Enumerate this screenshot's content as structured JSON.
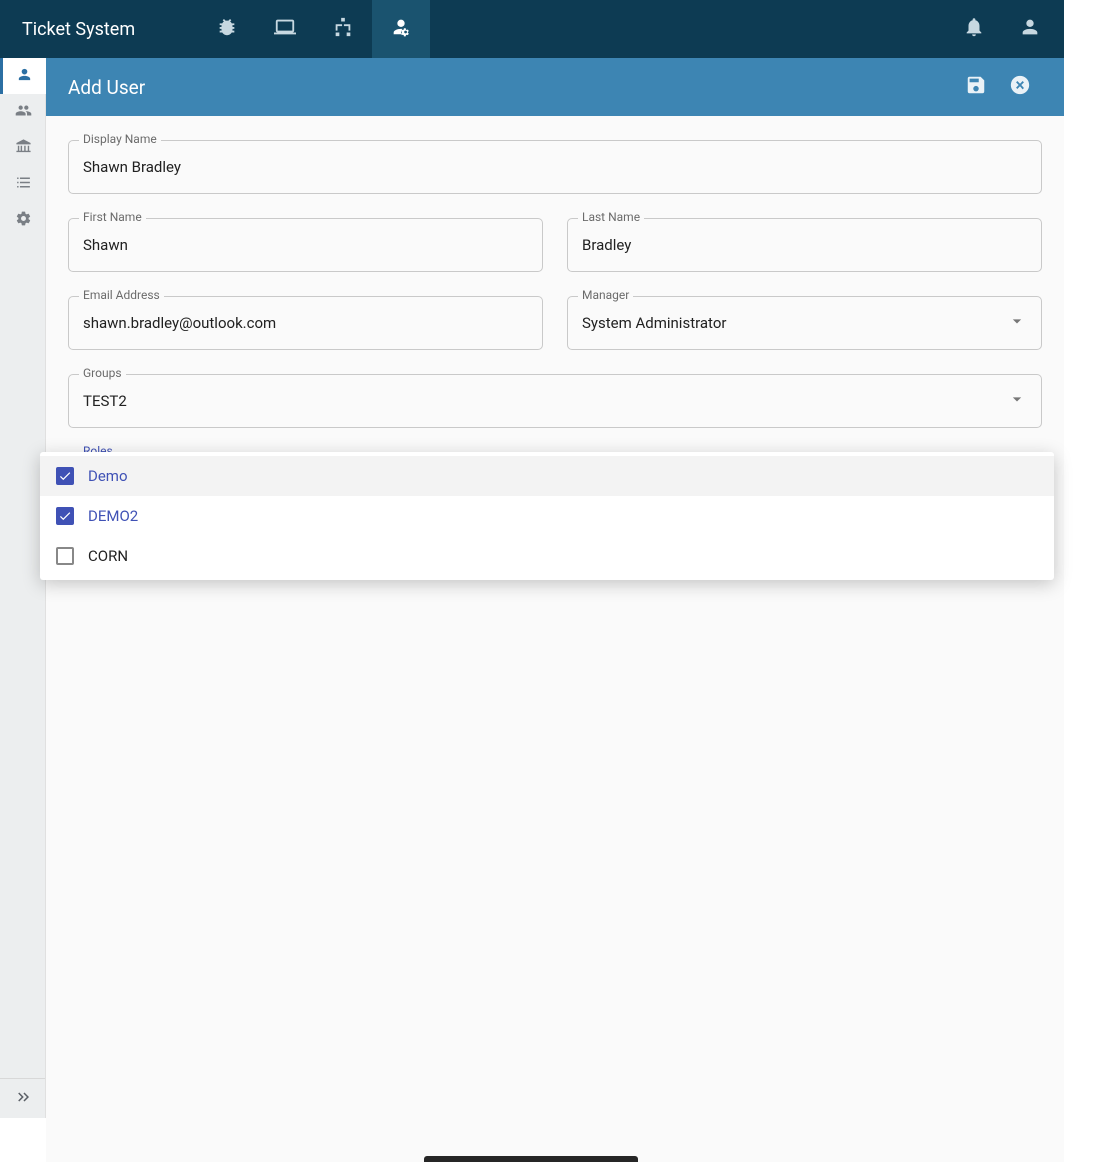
{
  "brand": "Ticket System",
  "topnav": {
    "items": [
      "bugs",
      "devices",
      "sitemap",
      "user-admin"
    ],
    "activeIndex": 3
  },
  "toprightIcons": [
    "notifications",
    "account"
  ],
  "sidebar": {
    "items": [
      "user",
      "group",
      "org",
      "list",
      "settings"
    ],
    "activeIndex": 0
  },
  "page": {
    "title": "Add User",
    "actions": [
      "save",
      "close"
    ]
  },
  "form": {
    "displayName": {
      "label": "Display Name",
      "value": "Shawn Bradley"
    },
    "firstName": {
      "label": "First Name",
      "value": "Shawn"
    },
    "lastName": {
      "label": "Last Name",
      "value": "Bradley"
    },
    "email": {
      "label": "Email Address",
      "value": "shawn.bradley@outlook.com"
    },
    "manager": {
      "label": "Manager",
      "value": "System Administrator"
    },
    "groups": {
      "label": "Groups",
      "value": "TEST2"
    },
    "roles": {
      "label": "Roles"
    }
  },
  "rolesDropdown": {
    "options": [
      {
        "label": "Demo",
        "checked": true
      },
      {
        "label": "DEMO2",
        "checked": true
      },
      {
        "label": "CORN",
        "checked": false
      }
    ]
  }
}
